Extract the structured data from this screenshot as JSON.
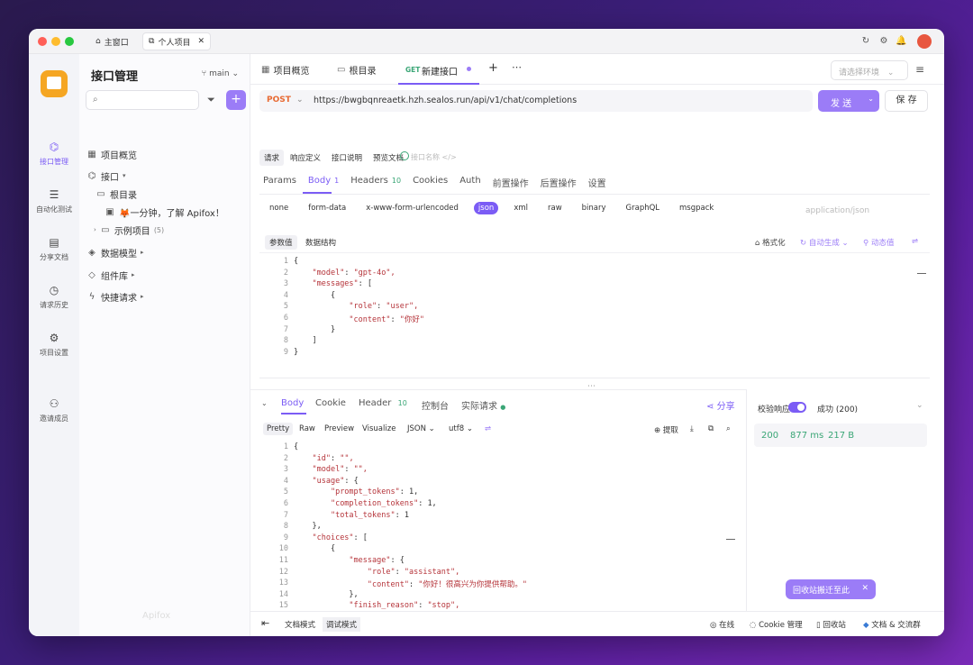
{
  "window": {
    "tabs": [
      {
        "label": "主窗口"
      },
      {
        "label": "个人项目"
      }
    ],
    "colors": {
      "accent": "#7b5cf5",
      "method": "#e86a33",
      "success": "#3aa676"
    }
  },
  "rail": {
    "items": [
      {
        "label": "接口管理"
      },
      {
        "label": "自动化测试"
      },
      {
        "label": "分享文档"
      },
      {
        "label": "请求历史"
      },
      {
        "label": "项目设置"
      },
      {
        "label": "邀请成员"
      }
    ]
  },
  "sidebar": {
    "title": "接口管理",
    "branch": "main",
    "tree": [
      {
        "label": "项目概览"
      },
      {
        "label": "接口"
      },
      {
        "label": "根目录"
      },
      {
        "label": "🦊一分钟，了解 Apifox！"
      },
      {
        "label": "示例项目"
      },
      {
        "count": "(5)"
      },
      {
        "label": "数据模型"
      },
      {
        "label": "组件库"
      },
      {
        "label": "快捷请求"
      }
    ],
    "watermark": "Apifox"
  },
  "main": {
    "tabs": [
      {
        "label": "项目概览"
      },
      {
        "label": "根目录"
      },
      {
        "method": "GET",
        "label": "新建接口"
      }
    ],
    "env_placeholder": "请选择环境",
    "method": "POST",
    "url": "https://bwgbqnreaetk.hzh.sealos.run/api/v1/chat/completions",
    "send_label": "发 送",
    "save_label": "保 存",
    "subtabs": [
      "请求",
      "响应定义",
      "接口说明",
      "预览文档"
    ],
    "api_name_placeholder": "接口名称",
    "req_tabs": [
      {
        "label": "Params"
      },
      {
        "label": "Body",
        "count": "1"
      },
      {
        "label": "Headers",
        "count": "10"
      },
      {
        "label": "Cookies"
      },
      {
        "label": "Auth"
      },
      {
        "label": "前置操作"
      },
      {
        "label": "后置操作"
      },
      {
        "label": "设置"
      }
    ],
    "body_types": [
      "none",
      "form-data",
      "x-www-form-urlencoded",
      "json",
      "xml",
      "raw",
      "binary",
      "GraphQL",
      "msgpack"
    ],
    "content_type": "application/json",
    "param_tabs": [
      "参数值",
      "数据结构"
    ],
    "tools": {
      "format": "格式化",
      "auto": "自动生成",
      "dynamic": "动态值"
    },
    "request_body": [
      "{",
      "    \"model\": \"gpt-4o\",",
      "    \"messages\": [",
      "        {",
      "            \"role\": \"user\",",
      "            \"content\": \"你好\"",
      "        }",
      "    ]",
      "}"
    ]
  },
  "response": {
    "tabs": [
      {
        "label": "Body"
      },
      {
        "label": "Cookie"
      },
      {
        "label": "Header",
        "count": "10"
      },
      {
        "label": "控制台"
      },
      {
        "label": "实际请求"
      }
    ],
    "share_label": "分享",
    "formats": [
      "Pretty",
      "Raw",
      "Preview",
      "Visualize",
      "JSON",
      "utf8"
    ],
    "extract_label": "提取",
    "body": [
      "{",
      "    \"id\": \"\",",
      "    \"model\": \"\",",
      "    \"usage\": {",
      "        \"prompt_tokens\": 1,",
      "        \"completion_tokens\": 1,",
      "        \"total_tokens\": 1",
      "    },",
      "    \"choices\": [",
      "        {",
      "            \"message\": {",
      "                \"role\": \"assistant\",",
      "                \"content\": \"你好！很高兴为你提供帮助。\"",
      "            },",
      "            \"finish_reason\": \"stop\",",
      "            \"index\": 0",
      "        }"
    ],
    "validate_label": "校验响应",
    "validate_result": "成功 (200)",
    "status": "200",
    "time": "877 ms",
    "size": "217 B"
  },
  "bottom": {
    "doc_mode": "文档模式",
    "debug_mode": "调试模式",
    "online": "在线",
    "cookie": "Cookie 管理",
    "trash": "回收站",
    "docs": "文档 & 交流群"
  },
  "toast": {
    "text": "回收站搬迁至此"
  }
}
